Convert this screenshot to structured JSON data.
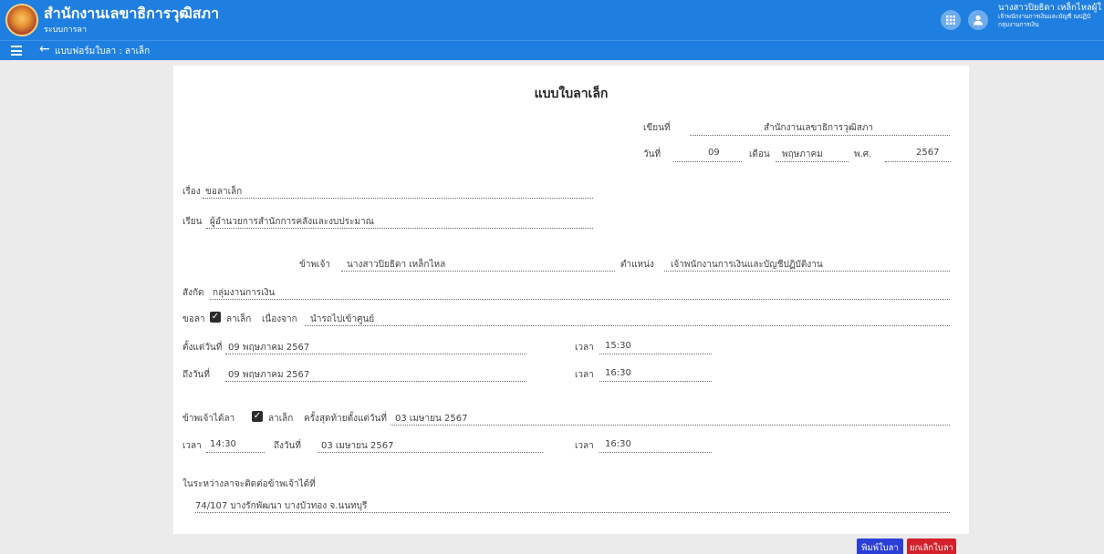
{
  "header": {
    "org_title": "สำนักงานเลขาธิการวุฒิสภา",
    "system": "ระบบการลา",
    "user_name": "นางสาวปิยธิดา เหล็กไหลผู้ใ",
    "user_position": "เจ้าพนักงานการเงินและบัญชี ณปฏิบั",
    "user_dept": "กลุ่มงานการเงิน"
  },
  "nav": {
    "breadcrumb": "แบบฟอร์มใบลา : ลาเล็ก"
  },
  "form": {
    "title": "แบบใบลาเล็ก",
    "written_at_label": "เขียนที่",
    "written_at": "สำนักงานเลขาธิการวุฒิสภา",
    "date_label": "วันที่",
    "date_day": "09",
    "month_label": "เดือน",
    "date_month": "พฤษภาคม",
    "year_label": "พ.ศ.",
    "date_year": "2567",
    "subject_label": "เรื่อง",
    "subject": "ขอลาเล็ก",
    "to_label": "เรียน",
    "to": "ผู้อำนวยการสำนักการคลังและงบประมาณ",
    "name_label": "ข้าพเจ้า",
    "name": "นางสาวปิยธิดา เหล็กไหล",
    "position_label": "ตำแหน่ง",
    "position": "เจ้าพนักงานการเงินและบัญชีปฏิบัติงาน",
    "dept_label": "สังกัด",
    "dept": "กลุ่มงานการเงิน",
    "request_label": "ขอลา",
    "leave_type": "ลาเล็ก",
    "leave_checked": true,
    "reason_label": "เนื่องจาก",
    "reason": "นำรถไปเข้าศูนย์",
    "from_label": "ตั้งแต่วันที่",
    "from_date": "09 พฤษภาคม 2567",
    "from_time_label": "เวลา",
    "from_time": "15:30",
    "to_date_label": "ถึงวันที่",
    "to_date": "09 พฤษภาคม 2567",
    "to_time_label": "เวลา",
    "to_time": "16:30",
    "last_label": "ข้าพเจ้าได้ลา",
    "last_type": "ลาเล็ก",
    "last_checked": true,
    "last_from_label": "ครั้งสุดท้ายตั้งแต่วันที่",
    "last_from": "03 เมษายน 2567",
    "last_time_label": "เวลา",
    "last_time": "14:30",
    "last_to_label": "ถึงวันที่",
    "last_to": "03 เมษายน 2567",
    "last_end_time_label": "เวลา",
    "last_end_time": "16:30",
    "contact_label": "ในระหว่างลาจะติดต่อข้าพเจ้าได้ที่",
    "contact": "74/107 บางรักพัฒนา บางบัวทอง จ.นนทบุรี"
  },
  "buttons": {
    "print": "พิมพ์ใบลา",
    "cancel": "ยกเลิกใบลา"
  },
  "icons": {
    "apps": "apps-grid-icon",
    "user": "user-avatar-icon",
    "menu": "hamburger-menu-icon",
    "back": "arrow-left-icon",
    "checkbox": "checkbox-checked-icon"
  },
  "colors": {
    "primary": "#1f7fe0",
    "print_button": "#2a3fd6",
    "cancel_button": "#d3202a",
    "background": "#ebebeb"
  }
}
